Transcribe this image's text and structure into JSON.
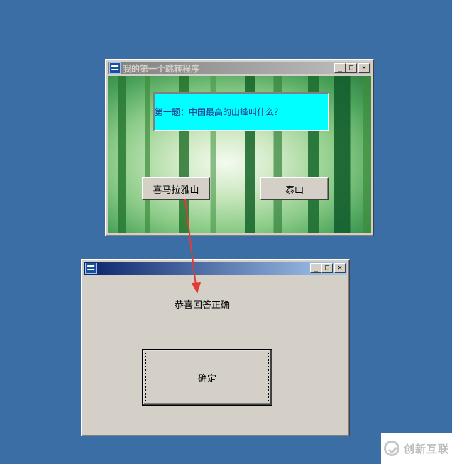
{
  "window1": {
    "title": "我的第一个跳转程序",
    "question": "第一题：中国最高的山峰叫什么？",
    "option1_label": "喜马拉雅山",
    "option2_label": "泰山",
    "controls": {
      "minimize": "_",
      "maximize": "□",
      "close": "✕"
    }
  },
  "window2": {
    "title": "",
    "message": "恭喜回答正确",
    "ok_label": "确定",
    "controls": {
      "minimize": "_",
      "maximize": "□",
      "close": "✕"
    }
  },
  "watermark": {
    "text": "创新互联"
  },
  "colors": {
    "desktop": "#3a6ea5",
    "question_bg": "#00ffff",
    "arrow": "#e53935",
    "active_title_start": "#0a246a",
    "active_title_end": "#a6caf0"
  },
  "icons": [
    "app-icon",
    "minimize-icon",
    "maximize-icon",
    "close-icon",
    "arrow-annotation",
    "watermark-logo"
  ]
}
